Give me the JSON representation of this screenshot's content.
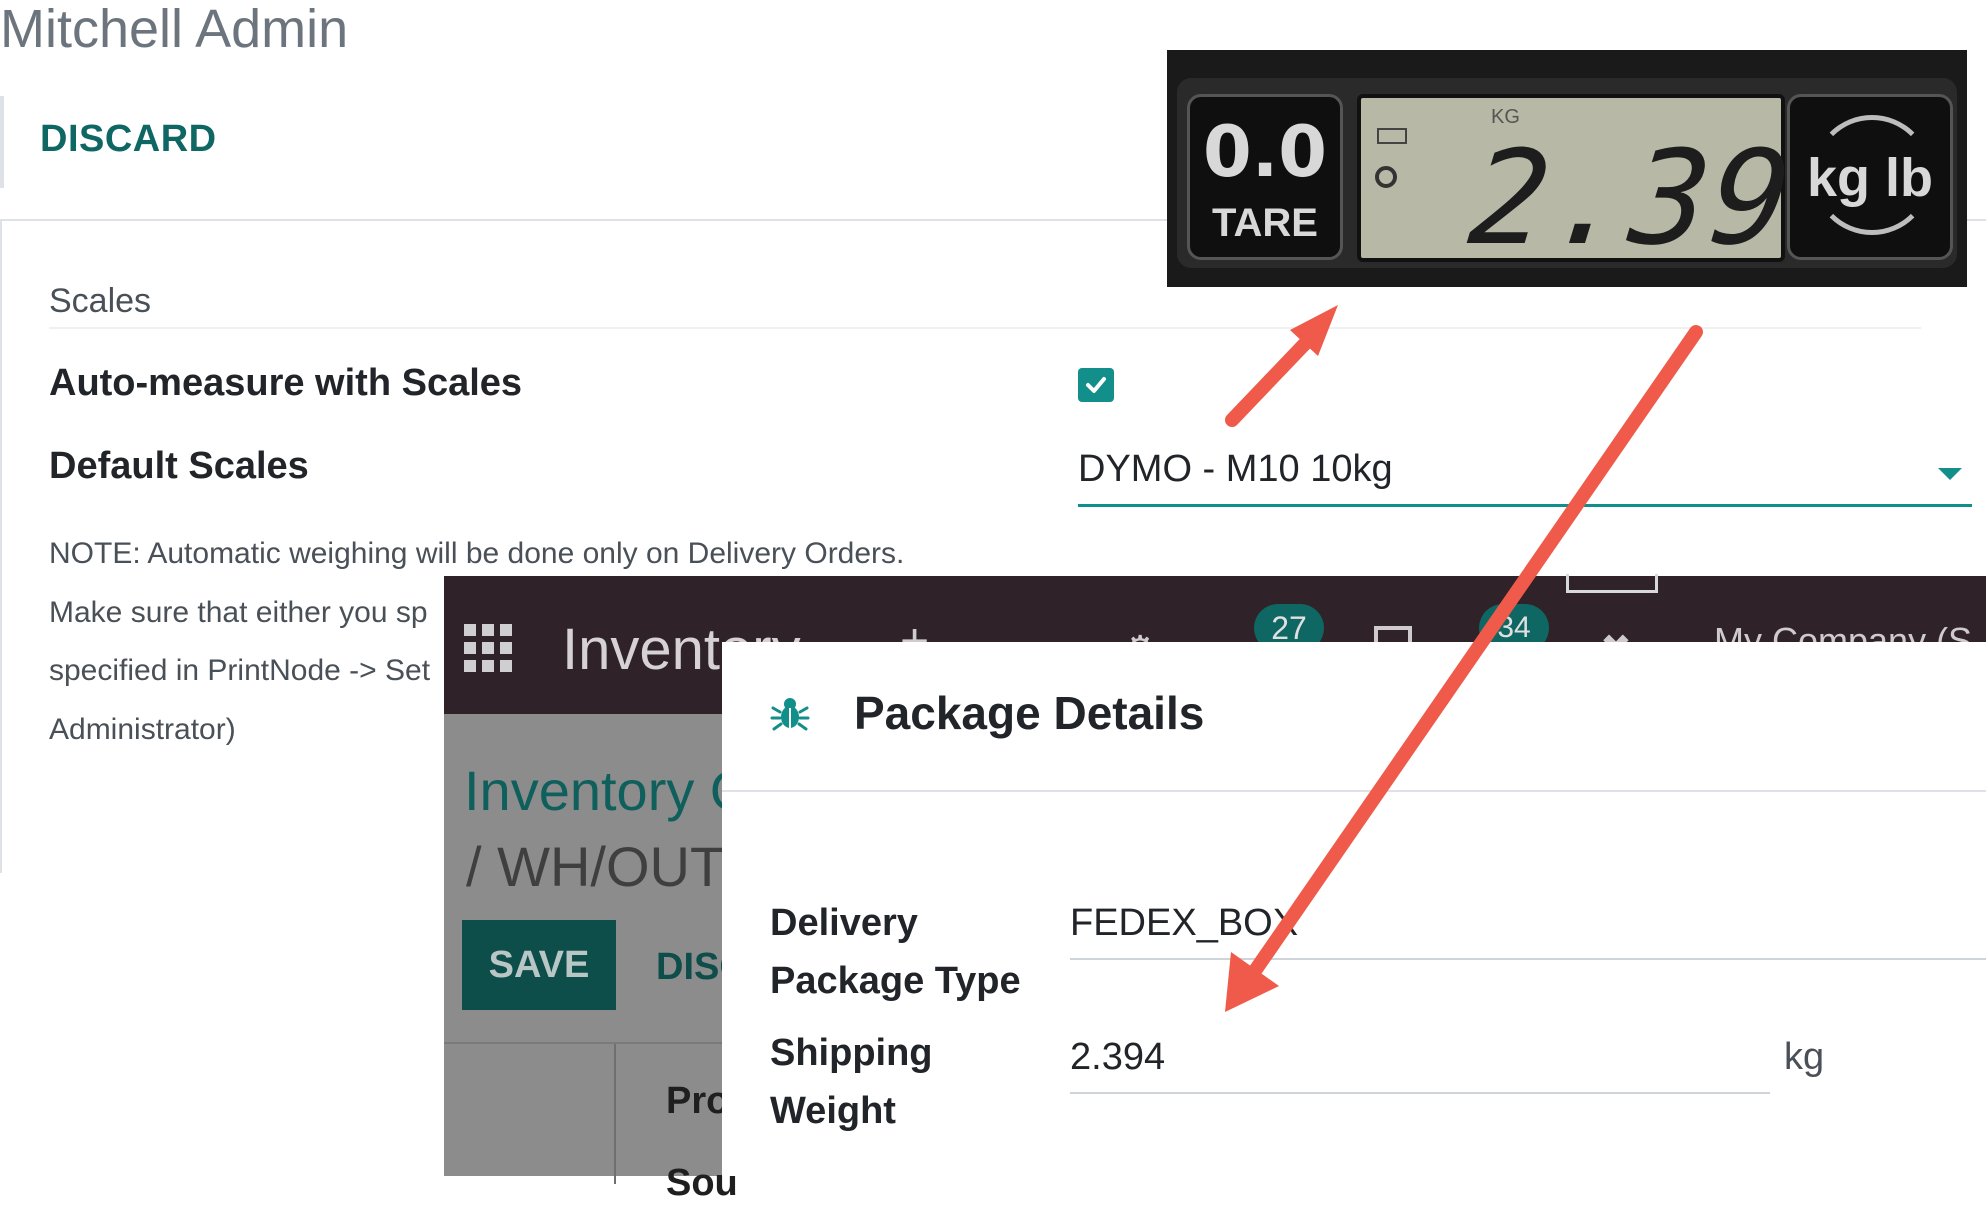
{
  "settings": {
    "user_name": "Mitchell Admin",
    "discard_label": "DISCARD",
    "section_title": "Scales",
    "auto_measure_label": "Auto-measure with Scales",
    "auto_measure_checked": true,
    "default_scales_label": "Default Scales",
    "default_scales_value": "DYMO - M10 10kg",
    "note_lines": [
      "NOTE: Automatic weighing will be done only on Delivery Orders.",
      "Make sure that either you sp",
      "specified in PrintNode -> Set",
      "Administrator)"
    ]
  },
  "scale_display": {
    "tare_value": "0.0",
    "tare_label": "TARE",
    "unit_indicator": "KG",
    "reading": "2.394",
    "unit_button": "kg lb"
  },
  "inventory_app": {
    "app_title": "Inventory",
    "plus_icon": "+",
    "chat_count": "27",
    "activity_count": "34",
    "company": "My Company (S",
    "breadcrumb_parent": "Inventory O",
    "breadcrumb_current": "/ WH/OUT/",
    "save_label": "SAVE",
    "discard_label": "DISC",
    "field_product": "Pro",
    "field_source": "Sou"
  },
  "dialog": {
    "title": "Package Details",
    "delivery_package_type_label": "Delivery Package Type",
    "delivery_package_type_value": "FEDEX_BOX",
    "shipping_weight_label": "Shipping Weight",
    "shipping_weight_value": "2.394",
    "shipping_weight_unit": "kg"
  },
  "colors": {
    "accent_teal": "#128f8b",
    "nav_purple": "#3a2a33",
    "arrow_red": "#ef5a4a"
  },
  "icons": [
    "check-icon",
    "caret-down-icon",
    "apps-grid-icon",
    "bug-icon",
    "chat-icon",
    "document-icon",
    "clock-icon",
    "tools-icon"
  ]
}
